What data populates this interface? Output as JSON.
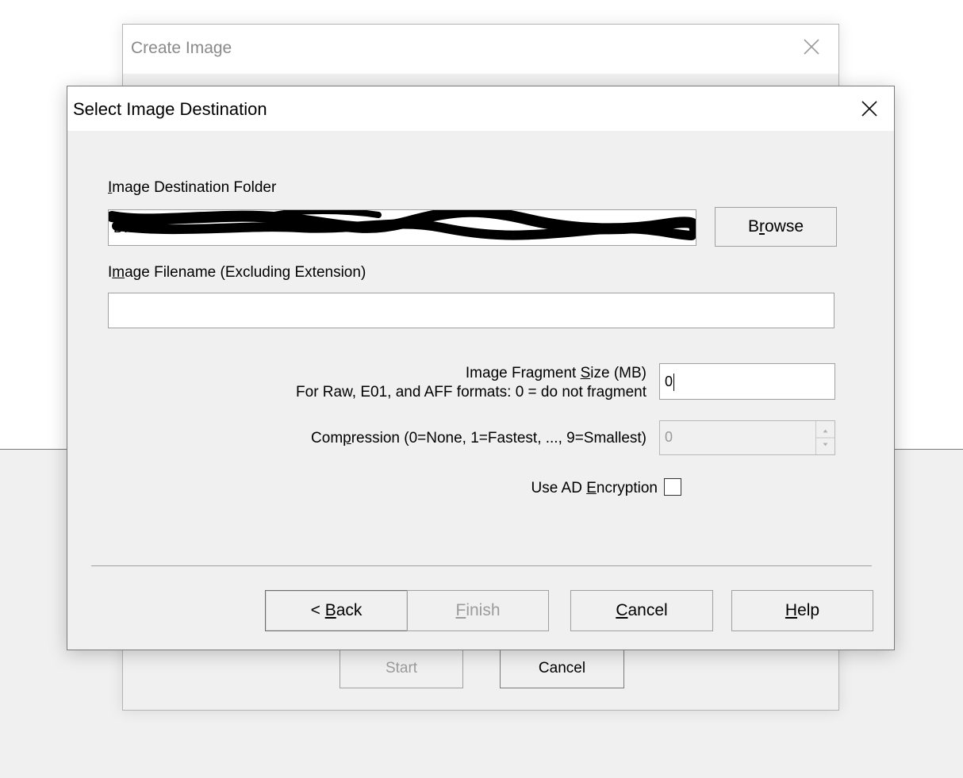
{
  "back_window": {
    "title": "Create Image",
    "start_label": "Start",
    "cancel_label": "Cancel"
  },
  "dialog": {
    "title": "Select Image Destination",
    "folder": {
      "label_hotkey": "I",
      "label_rest": "mage Destination Folder",
      "value": "D:\\",
      "browse_pre": "B",
      "browse_hotkey": "r",
      "browse_post": "owse"
    },
    "filename": {
      "label_pre": "I",
      "label_hotkey": "m",
      "label_post": "age Filename (Excluding Extension)",
      "value": ""
    },
    "fragment": {
      "label_pre": "Image Fragment ",
      "label_hotkey": "S",
      "label_post": "ize (MB)",
      "note": "For Raw, E01, and AFF formats: 0 = do not fragment",
      "value": "0"
    },
    "compression": {
      "label_pre": "Com",
      "label_hotkey": "p",
      "label_post": "ression (0=None, 1=Fastest, ..., 9=Smallest)",
      "value": "0"
    },
    "encryption": {
      "label_pre": "Use AD ",
      "label_hotkey": "E",
      "label_post": "ncryption",
      "checked": false
    },
    "buttons": {
      "back_pre": "< ",
      "back_hotkey": "B",
      "back_post": "ack",
      "finish_hotkey": "F",
      "finish_post": "inish",
      "cancel_hotkey": "C",
      "cancel_post": "ancel",
      "help_hotkey": "H",
      "help_post": "elp"
    }
  },
  "icons": {
    "close": "close-icon",
    "spin": "spin-arrows-icon",
    "redaction": "redaction-scribble"
  },
  "colors": {
    "window_bg": "#f0f0f0",
    "title_bg": "#ffffff",
    "disabled_text": "#9c9c9c"
  }
}
